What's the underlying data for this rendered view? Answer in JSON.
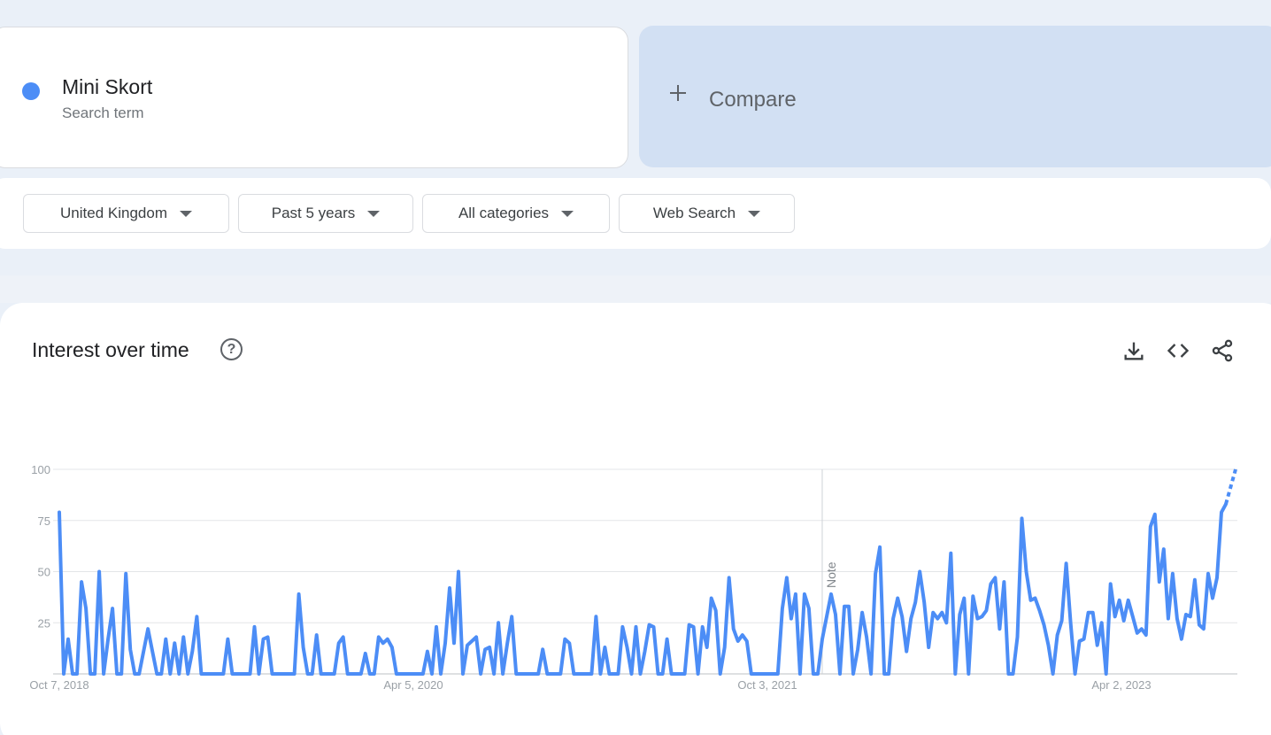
{
  "term": {
    "name": "Mini Skort",
    "type": "Search term",
    "color": "#4c8df6"
  },
  "compare": {
    "label": "Compare"
  },
  "filters": [
    {
      "label": "United Kingdom"
    },
    {
      "label": "Past 5 years"
    },
    {
      "label": "All categories"
    },
    {
      "label": "Web Search"
    }
  ],
  "panel": {
    "title": "Interest over time",
    "help_icon": "help-circle-icon",
    "actions": [
      "download-icon",
      "embed-code-icon",
      "share-icon"
    ]
  },
  "chart_data": {
    "type": "line",
    "series": [
      {
        "name": "Mini Skort",
        "color": "#4c8df6",
        "values": [
          79,
          0,
          17,
          0,
          0,
          45,
          32,
          0,
          0,
          50,
          0,
          17,
          32,
          0,
          0,
          49,
          12,
          0,
          0,
          11,
          22,
          11,
          0,
          0,
          17,
          0,
          15,
          0,
          18,
          0,
          11,
          28,
          0,
          0,
          0,
          0,
          0,
          0,
          17,
          0,
          0,
          0,
          0,
          0,
          23,
          0,
          17,
          18,
          0,
          0,
          0,
          0,
          0,
          0,
          39,
          13,
          0,
          0,
          19,
          0,
          0,
          0,
          0,
          15,
          18,
          0,
          0,
          0,
          0,
          10,
          0,
          0,
          18,
          15,
          17,
          13,
          0,
          0,
          0,
          0,
          0,
          0,
          0,
          11,
          0,
          23,
          0,
          15,
          42,
          15,
          50,
          0,
          14,
          16,
          18,
          0,
          12,
          13,
          0,
          25,
          0,
          15,
          28,
          0,
          0,
          0,
          0,
          0,
          0,
          12,
          0,
          0,
          0,
          0,
          17,
          15,
          0,
          0,
          0,
          0,
          0,
          28,
          0,
          13,
          0,
          0,
          0,
          23,
          13,
          0,
          23,
          0,
          11,
          24,
          23,
          0,
          0,
          17,
          0,
          0,
          0,
          0,
          24,
          23,
          0,
          23,
          13,
          37,
          31,
          0,
          13,
          47,
          22,
          16,
          19,
          16,
          0,
          0,
          0,
          0,
          0,
          0,
          0,
          32,
          47,
          27,
          39,
          0,
          39,
          32,
          0,
          0,
          17,
          28,
          39,
          29,
          0,
          33,
          33,
          0,
          12,
          30,
          18,
          0,
          49,
          62,
          0,
          0,
          27,
          37,
          28,
          11,
          27,
          35,
          50,
          35,
          13,
          30,
          27,
          30,
          25,
          59,
          0,
          29,
          37,
          0,
          38,
          27,
          28,
          31,
          44,
          47,
          22,
          45,
          0,
          0,
          18,
          76,
          50,
          36,
          37,
          31,
          24,
          14,
          0,
          19,
          26,
          54,
          25,
          0,
          16,
          17,
          30,
          30,
          14,
          25,
          0,
          44,
          28,
          36,
          26,
          36,
          28,
          20,
          22,
          19,
          72,
          78,
          45,
          61,
          27,
          49,
          27,
          17,
          29,
          28,
          46,
          24,
          22,
          49,
          37,
          47,
          79,
          83
        ],
        "partial_tail": [
          83,
          100
        ]
      }
    ],
    "x_tick_labels": [
      "Oct 7, 2018",
      "Apr 5, 2020",
      "Oct 3, 2021",
      "Apr 2, 2023"
    ],
    "y_ticks": [
      100,
      75,
      50,
      25
    ],
    "ylim": [
      0,
      100
    ],
    "annotation": "Note",
    "grid": true
  }
}
